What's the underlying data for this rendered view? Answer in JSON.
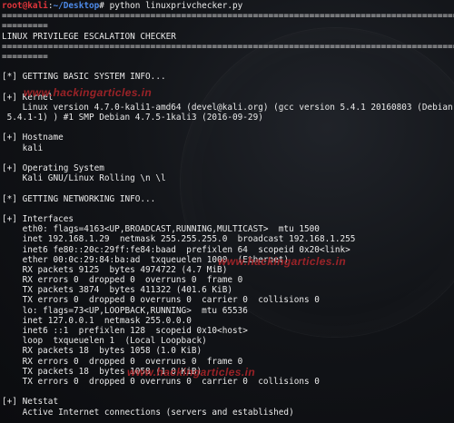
{
  "prompt": {
    "user": "root@kali",
    "separator": ":",
    "path": "~/Desktop",
    "symbol": "#",
    "command": " python linuxprivchecker.py"
  },
  "watermark_text": "www.hackingarticles.in",
  "lines": [
    "=============================================================================================",
    "=========",
    "LINUX PRIVILEGE ESCALATION CHECKER",
    "=============================================================================================",
    "=========",
    "",
    "[*] GETTING BASIC SYSTEM INFO...",
    "",
    "[+] Kernel",
    "    Linux version 4.7.0-kali1-amd64 (devel@kali.org) (gcc version 5.4.1 20160803 (Debian",
    " 5.4.1-1) ) #1 SMP Debian 4.7.5-1kali3 (2016-09-29)",
    "",
    "[+] Hostname",
    "    kali",
    "",
    "[+] Operating System",
    "    Kali GNU/Linux Rolling \\n \\l",
    "",
    "[*] GETTING NETWORKING INFO...",
    "",
    "[+] Interfaces",
    "    eth0: flags=4163<UP,BROADCAST,RUNNING,MULTICAST>  mtu 1500",
    "    inet 192.168.1.29  netmask 255.255.255.0  broadcast 192.168.1.255",
    "    inet6 fe80::20c:29ff:fe84:baad  prefixlen 64  scopeid 0x20<link>",
    "    ether 00:0c:29:84:ba:ad  txqueuelen 1000  (Ethernet)",
    "    RX packets 9125  bytes 4974722 (4.7 MiB)",
    "    RX errors 0  dropped 0  overruns 0  frame 0",
    "    TX packets 3874  bytes 411322 (401.6 KiB)",
    "    TX errors 0  dropped 0 overruns 0  carrier 0  collisions 0",
    "    lo: flags=73<UP,LOOPBACK,RUNNING>  mtu 65536",
    "    inet 127.0.0.1  netmask 255.0.0.0",
    "    inet6 ::1  prefixlen 128  scopeid 0x10<host>",
    "    loop  txqueuelen 1  (Local Loopback)",
    "    RX packets 18  bytes 1058 (1.0 KiB)",
    "    RX errors 0  dropped 0  overruns 0  frame 0",
    "    TX packets 18  bytes 1058 (1.0 KiB)",
    "    TX errors 0  dropped 0 overruns 0  carrier 0  collisions 0",
    "",
    "[+] Netstat",
    "    Active Internet connections (servers and established)"
  ]
}
